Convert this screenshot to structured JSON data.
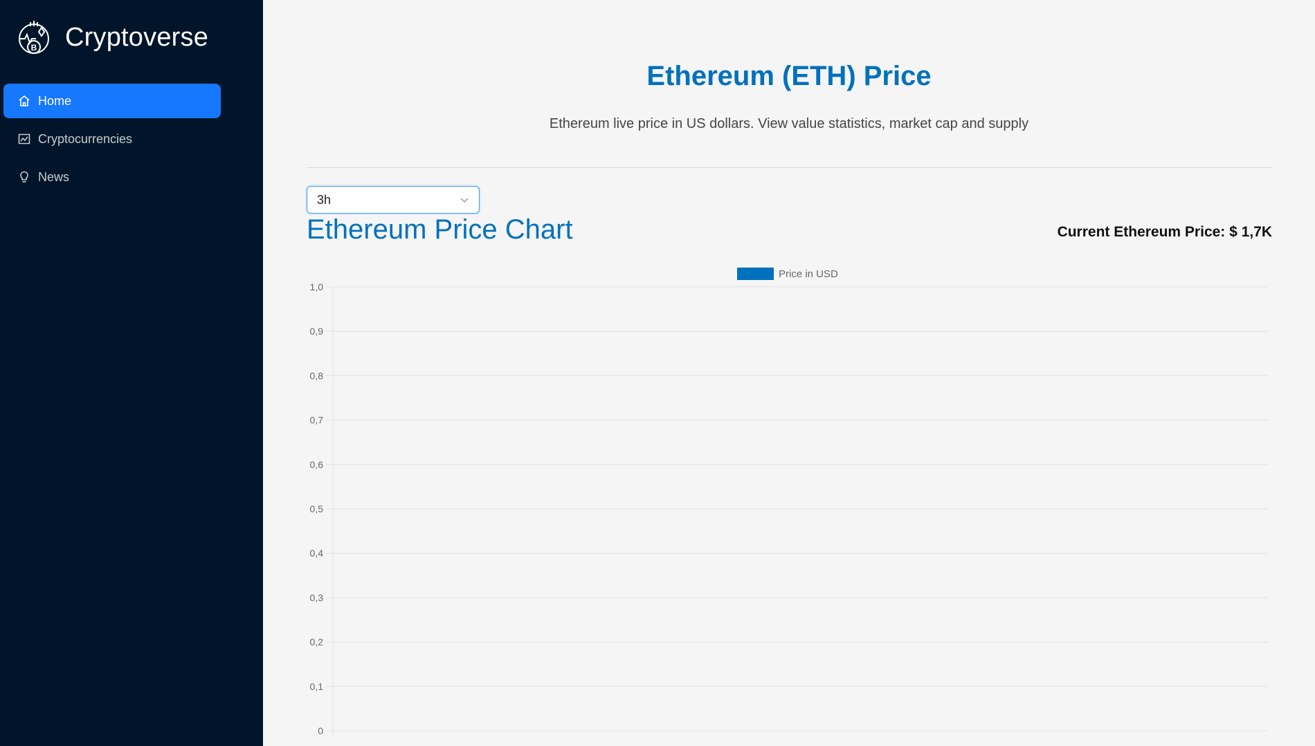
{
  "app": {
    "name": "Cryptoverse"
  },
  "sidebar": {
    "items": [
      {
        "label": "Home",
        "icon": "home-icon",
        "active": true
      },
      {
        "label": "Cryptocurrencies",
        "icon": "fund-icon",
        "active": false
      },
      {
        "label": "News",
        "icon": "bulb-icon",
        "active": false
      }
    ]
  },
  "main": {
    "heading": "Ethereum (ETH) Price",
    "subheading": "Ethereum live price in US dollars. View value statistics, market cap and supply",
    "period_select": {
      "value": "3h"
    },
    "chart_title": "Ethereum Price Chart",
    "current_price": "Current Ethereum Price: $ 1,7K"
  },
  "colors": {
    "accent": "#0071bd",
    "sidebar": "#001529",
    "active": "#1677ff",
    "series": "#0071bd"
  },
  "chart_data": {
    "type": "line",
    "series": [
      {
        "name": "Price in USD",
        "values": []
      }
    ],
    "x": [],
    "ylim": [
      0,
      1
    ],
    "yticks": [
      "0",
      "0,1",
      "0,2",
      "0,3",
      "0,4",
      "0,5",
      "0,6",
      "0,7",
      "0,8",
      "0,9",
      "1,0"
    ],
    "grid": true,
    "legend": "top-center"
  }
}
